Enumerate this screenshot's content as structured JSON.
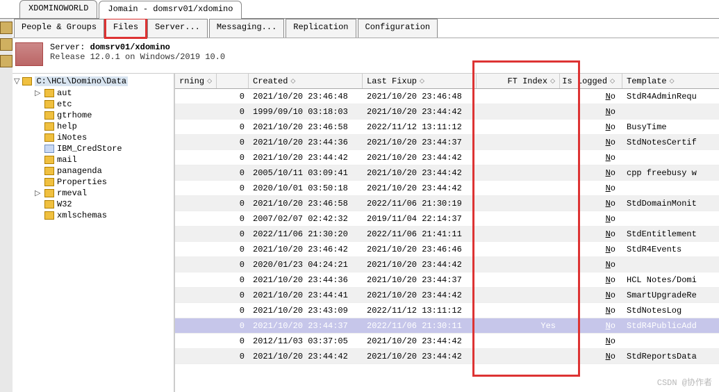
{
  "app_tabs": {
    "tab1": "XDOMINOWORLD",
    "tab2": "Jomain - domsrv01/xdomino"
  },
  "inner_tabs": {
    "people": "People & Groups",
    "files": "Files",
    "server": "Server...",
    "messaging": "Messaging...",
    "replication": "Replication",
    "configuration": "Configuration"
  },
  "server": {
    "label": "Server:",
    "name": "domsrv01/xdomino",
    "release": "Release 12.0.1 on Windows/2019 10.0"
  },
  "tree": {
    "root": "C:\\HCL\\Domino\\Data",
    "items": [
      {
        "label": "aut",
        "expandable": true
      },
      {
        "label": "etc"
      },
      {
        "label": "gtrhome"
      },
      {
        "label": "help"
      },
      {
        "label": "iNotes"
      },
      {
        "label": "IBM_CredStore",
        "blue": true
      },
      {
        "label": "mail"
      },
      {
        "label": "panagenda"
      },
      {
        "label": "Properties"
      },
      {
        "label": "rmeval",
        "expandable": true
      },
      {
        "label": "W32"
      },
      {
        "label": "xmlschemas"
      }
    ]
  },
  "grid": {
    "headers": {
      "rning": "rning",
      "created": "Created",
      "last_fixup": "Last Fixup",
      "ft_index": "FT Index",
      "is_logged": "Is Logged",
      "template": "Template"
    },
    "rows": [
      {
        "z": "0",
        "created": "2021/10/20 23:46:48",
        "fixup": "2021/10/20 23:46:48",
        "ft": "",
        "log": "No",
        "tpl": "StdR4AdminRequ"
      },
      {
        "z": "0",
        "created": "1999/09/10 03:18:03",
        "fixup": "2021/10/20 23:44:42",
        "ft": "",
        "log": "No",
        "tpl": ""
      },
      {
        "z": "0",
        "created": "2021/10/20 23:46:58",
        "fixup": "2022/11/12 13:11:12",
        "ft": "",
        "log": "No",
        "tpl": "BusyTime"
      },
      {
        "z": "0",
        "created": "2021/10/20 23:44:36",
        "fixup": "2021/10/20 23:44:37",
        "ft": "",
        "log": "No",
        "tpl": "StdNotesCertif"
      },
      {
        "z": "0",
        "created": "2021/10/20 23:44:42",
        "fixup": "2021/10/20 23:44:42",
        "ft": "",
        "log": "No",
        "tpl": ""
      },
      {
        "z": "0",
        "created": "2005/10/11 03:09:41",
        "fixup": "2021/10/20 23:44:42",
        "ft": "",
        "log": "No",
        "tpl": "cpp freebusy w"
      },
      {
        "z": "0",
        "created": "2020/10/01 03:50:18",
        "fixup": "2021/10/20 23:44:42",
        "ft": "",
        "log": "No",
        "tpl": ""
      },
      {
        "z": "0",
        "created": "2021/10/20 23:46:58",
        "fixup": "2022/11/06 21:30:19",
        "ft": "",
        "log": "No",
        "tpl": "StdDomainMonit"
      },
      {
        "z": "0",
        "created": "2007/02/07 02:42:32",
        "fixup": "2019/11/04 22:14:37",
        "ft": "",
        "log": "No",
        "tpl": ""
      },
      {
        "z": "0",
        "created": "2022/11/06 21:30:20",
        "fixup": "2022/11/06 21:41:11",
        "ft": "",
        "log": "No",
        "tpl": "StdEntitlement"
      },
      {
        "z": "0",
        "created": "2021/10/20 23:46:42",
        "fixup": "2021/10/20 23:46:46",
        "ft": "",
        "log": "No",
        "tpl": "StdR4Events"
      },
      {
        "z": "0",
        "created": "2020/01/23 04:24:21",
        "fixup": "2021/10/20 23:44:42",
        "ft": "",
        "log": "No",
        "tpl": ""
      },
      {
        "z": "0",
        "created": "2021/10/20 23:44:36",
        "fixup": "2021/10/20 23:44:37",
        "ft": "",
        "log": "No",
        "tpl": "HCL Notes/Domi"
      },
      {
        "z": "0",
        "created": "2021/10/20 23:44:41",
        "fixup": "2021/10/20 23:44:42",
        "ft": "",
        "log": "No",
        "tpl": "SmartUpgradeRe"
      },
      {
        "z": "0",
        "created": "2021/10/20 23:43:09",
        "fixup": "2022/11/12 13:11:12",
        "ft": "",
        "log": "No",
        "tpl": "StdNotesLog"
      },
      {
        "z": "0",
        "created": "2021/10/20 23:44:37",
        "fixup": "2022/11/06 21:30:11",
        "ft": "Yes",
        "log": "No",
        "tpl": "StdR4PublicAdd",
        "sel": true
      },
      {
        "z": "0",
        "created": "2012/11/03 03:37:05",
        "fixup": "2021/10/20 23:44:42",
        "ft": "",
        "log": "No",
        "tpl": ""
      },
      {
        "z": "0",
        "created": "2021/10/20 23:44:42",
        "fixup": "2021/10/20 23:44:42",
        "ft": "",
        "log": "No",
        "tpl": "StdReportsData"
      }
    ]
  },
  "watermark": "CSDN @协作者"
}
